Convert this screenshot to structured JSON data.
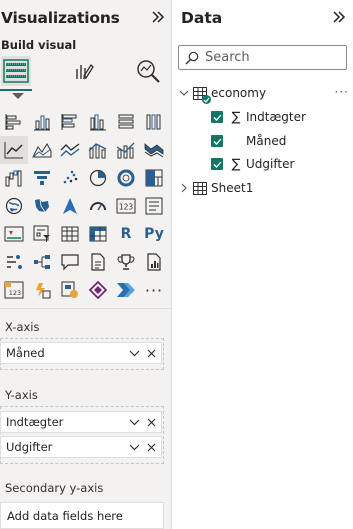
{
  "visualizations": {
    "title": "Visualizations",
    "build_visual_label": "Build visual",
    "gallery_text": {
      "r": "R",
      "py": "Py",
      "more": "···"
    }
  },
  "wells": {
    "x_axis": {
      "title": "X-axis",
      "fields": [
        "Måned"
      ]
    },
    "y_axis": {
      "title": "Y-axis",
      "fields": [
        "Indtægter",
        "Udgifter"
      ]
    },
    "secondary_y_axis": {
      "title": "Secondary y-axis",
      "placeholder": "Add data fields here"
    }
  },
  "data": {
    "title": "Data",
    "search": {
      "placeholder": "Search",
      "value": ""
    },
    "tables": [
      {
        "name": "economy",
        "expanded": true,
        "fields": [
          {
            "name": "Indtægter",
            "checked": true,
            "sigma": true
          },
          {
            "name": "Måned",
            "checked": true,
            "sigma": false
          },
          {
            "name": "Udgifter",
            "checked": true,
            "sigma": true
          }
        ]
      },
      {
        "name": "Sheet1",
        "expanded": false
      }
    ]
  },
  "icons": {
    "sigma_glyph": "∑",
    "more_options": "···"
  },
  "colors": {
    "accent": "#117865",
    "pane_bg": "#f3f2f1",
    "chart_blue": "#2a5f8f"
  }
}
